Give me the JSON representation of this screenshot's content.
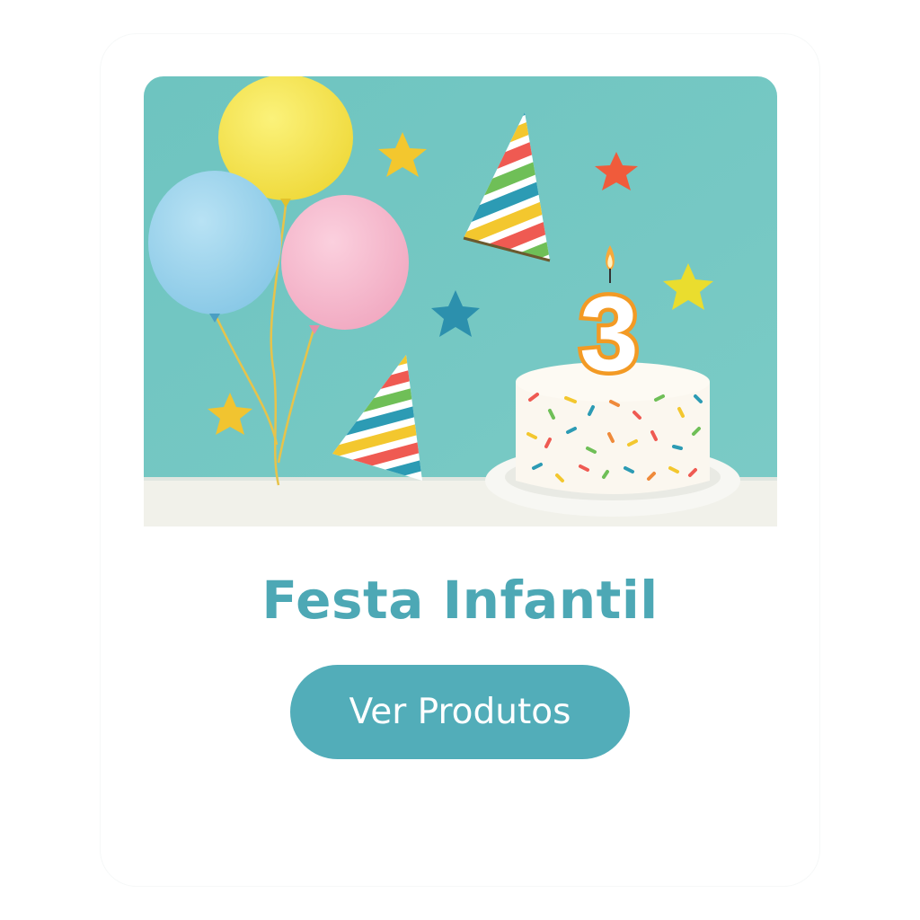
{
  "card": {
    "image_subject": "birthday-party-scene",
    "candle_number": "3",
    "title": "Festa Infantil",
    "cta_label": "Ver Produtos"
  },
  "colors": {
    "accent": "#52adb9",
    "title": "#4da8b5",
    "hero_background": "#72c6c2",
    "button_text": "#ffffff"
  }
}
